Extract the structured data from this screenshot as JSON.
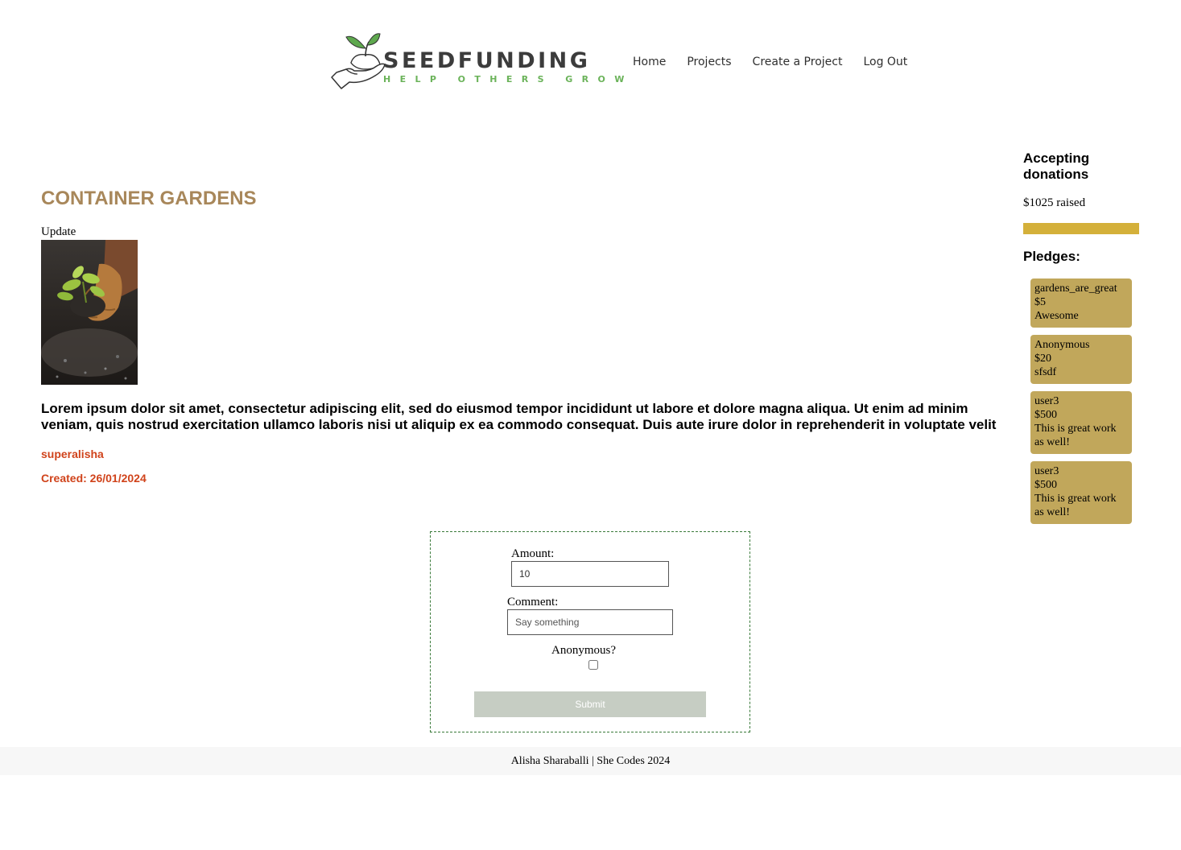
{
  "header": {
    "brand": "SEEDFUNDING",
    "tagline": "HELP OTHERS GROW",
    "nav": [
      "Home",
      "Projects",
      "Create a Project",
      "Log Out"
    ]
  },
  "project": {
    "title": "CONTAINER GARDENS",
    "update_label": "Update",
    "description": "Lorem ipsum dolor sit amet, consectetur adipiscing elit, sed do eiusmod tempor incididunt ut labore et dolore magna aliqua. Ut enim ad minim veniam, quis nostrud exercitation ullamco laboris nisi ut aliquip ex ea commodo consequat. Duis aute irure dolor in reprehenderit in voluptate velit",
    "owner": "superalisha",
    "created": "Created: 26/01/2024"
  },
  "sidebar": {
    "status": "Accepting donations",
    "raised": "$1025 raised",
    "progress_fraction": 1.0,
    "pledges_heading": "Pledges:",
    "pledges": [
      {
        "supporter": "gardens_are_great",
        "amount": "$5",
        "comment": "Awesome"
      },
      {
        "supporter": "Anonymous",
        "amount": "$20",
        "comment": "sfsdf"
      },
      {
        "supporter": "user3",
        "amount": "$500",
        "comment": "This is great work as well!"
      },
      {
        "supporter": "user3",
        "amount": "$500",
        "comment": "This is great work as well!"
      }
    ]
  },
  "form": {
    "amount_label": "Amount:",
    "amount_value": "10",
    "comment_label": "Comment:",
    "comment_placeholder": "Say something",
    "anonymous_label": "Anonymous?",
    "submit_label": "Submit"
  },
  "footer": {
    "text": "Alisha Sharaballi | She Codes 2024"
  },
  "colors": {
    "title": "#a8875a",
    "owner": "#d0431b",
    "progress": "#d4b03a",
    "pledge_card": "#c1a75b",
    "submit": "#c6cdc3",
    "brand_green": "#6bb35a"
  }
}
